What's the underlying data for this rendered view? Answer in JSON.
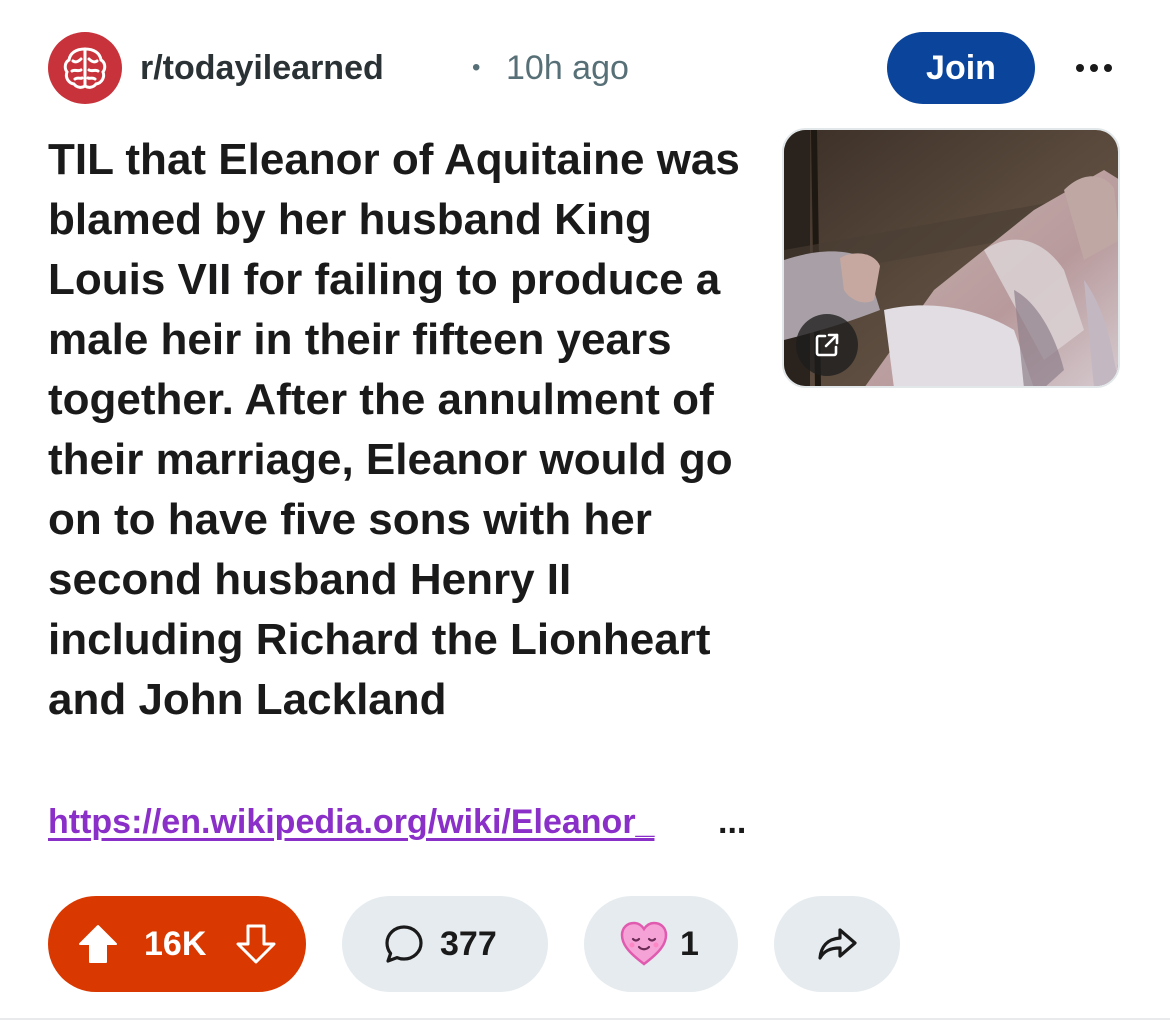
{
  "post": {
    "subreddit": "r/todayilearned",
    "separator": "•",
    "timestamp": "10h ago",
    "join_label": "Join",
    "title": "TIL that Eleanor of Aquitaine was blamed by her husband King Louis VII for failing to produce a male heir in their fifteen years together. After the annulment of their marriage, Eleanor would go on to have five sons with her second husband Henry II including Richard the Lionheart and John Lackland",
    "link_text": "https://en.wikipedia.org/wiki/Eleanor_",
    "link_ellipsis": "...",
    "thumbnail_icon": "external-link-icon"
  },
  "actions": {
    "vote_count": "16K",
    "comment_count": "377",
    "award_count": "1",
    "icons": {
      "upvote": "arrow-up-icon",
      "downvote": "arrow-down-icon",
      "comment": "speech-bubble-icon",
      "award": "heart-award-icon",
      "share": "share-arrow-icon"
    }
  },
  "colors": {
    "subreddit_avatar": "#c8323a",
    "join_button": "#0a449b",
    "vote_pill": "#d93900",
    "link": "#8b2fc9",
    "pill_background": "#e5ebee"
  }
}
